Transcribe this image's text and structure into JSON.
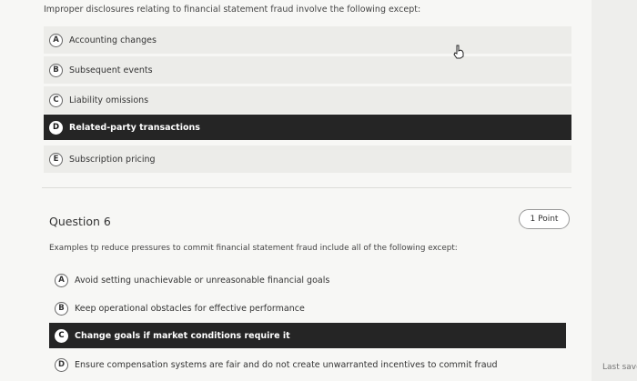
{
  "question5": {
    "prompt": "Improper disclosures relating to financial statement fraud involve the following except:",
    "options": [
      {
        "letter": "A",
        "label": "Accounting changes"
      },
      {
        "letter": "B",
        "label": "Subsequent events"
      },
      {
        "letter": "C",
        "label": "Liability omissions"
      },
      {
        "letter": "D",
        "label": "Related-party transactions",
        "selected": true
      },
      {
        "letter": "E",
        "label": "Subscription pricing"
      }
    ]
  },
  "question6": {
    "title": "Question 6",
    "points": "1 Point",
    "prompt": "Examples tp reduce pressures to commit financial statement fraud include all of the following except:",
    "options": [
      {
        "letter": "A",
        "label": "Avoid setting unachievable or unreasonable financial goals"
      },
      {
        "letter": "B",
        "label": "Keep operational obstacles for effective performance"
      },
      {
        "letter": "C",
        "label": "Change goals if market conditions require it",
        "selected": true
      },
      {
        "letter": "D",
        "label": "Ensure compensation systems are fair and do not create unwarranted incentives to commit fraud"
      }
    ]
  },
  "footer": {
    "last_saved": "Last save"
  },
  "colors": {
    "selected_bg": "#252525",
    "page_bg": "#f7f7f5"
  },
  "icons": {
    "cursor": "hand-pointer-icon"
  }
}
